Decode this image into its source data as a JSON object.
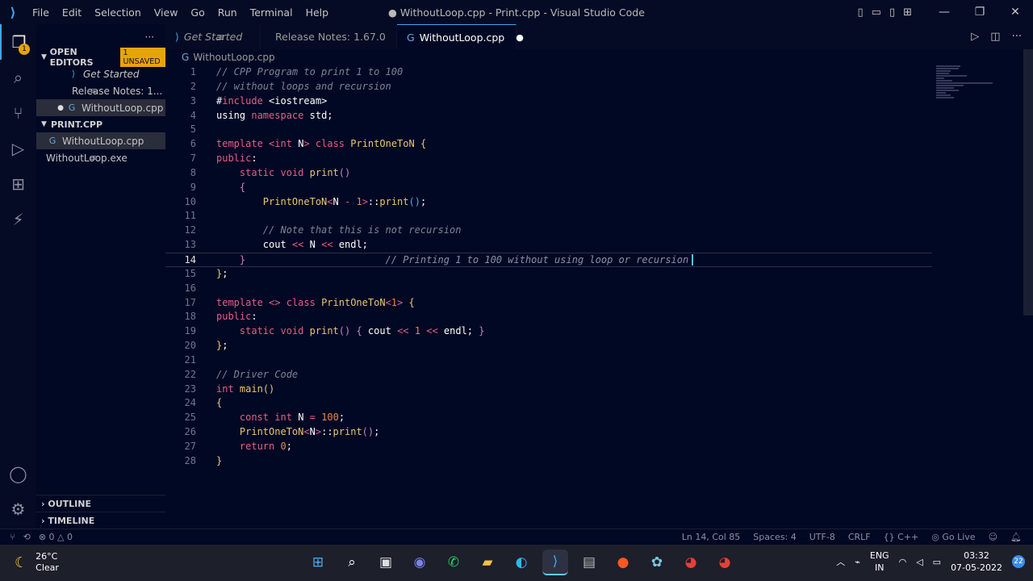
{
  "window": {
    "title": "● WithoutLoop.cpp - Print.cpp - Visual Studio Code",
    "menu": [
      "File",
      "Edit",
      "Selection",
      "View",
      "Go",
      "Run",
      "Terminal",
      "Help"
    ]
  },
  "activity": {
    "explorer_badge": "1"
  },
  "sidebar": {
    "open_editors_label": "OPEN EDITORS",
    "unsaved_badge": "1 UNSAVED",
    "open_editors": [
      {
        "label": "Get Started",
        "icon": "vscode-icon"
      },
      {
        "label": "Release Notes: 1...",
        "icon": "document-icon"
      },
      {
        "label": "WithoutLoop.cpp",
        "icon": "cpp-file-icon"
      }
    ],
    "folder_label": "PRINT.CPP",
    "files": [
      {
        "label": "WithoutLoop.cpp",
        "icon": "cpp-file-icon"
      },
      {
        "label": "WithoutLoop.exe",
        "icon": "document-icon"
      }
    ],
    "outline_label": "OUTLINE",
    "timeline_label": "TIMELINE"
  },
  "tabs": [
    {
      "label": "Get Started"
    },
    {
      "label": "Release Notes: 1.67.0"
    },
    {
      "label": "WithoutLoop.cpp"
    }
  ],
  "breadcrumb": "WithoutLoop.cpp",
  "editor": {
    "current_line": 14,
    "inline_hint": "// Printing 1 to 100 without using loop or recursion"
  },
  "statusbar": {
    "errors": "0",
    "warnings": "0",
    "position": "Ln 14, Col 85",
    "spaces": "Spaces: 4",
    "encoding": "UTF-8",
    "eol": "CRLF",
    "language": "C++",
    "golive": "Go Live"
  },
  "taskbar": {
    "temperature": "26°C",
    "weather": "Clear",
    "lang1": "ENG",
    "lang2": "IN",
    "time": "03:32",
    "date": "07-05-2022",
    "notifications": "22"
  }
}
